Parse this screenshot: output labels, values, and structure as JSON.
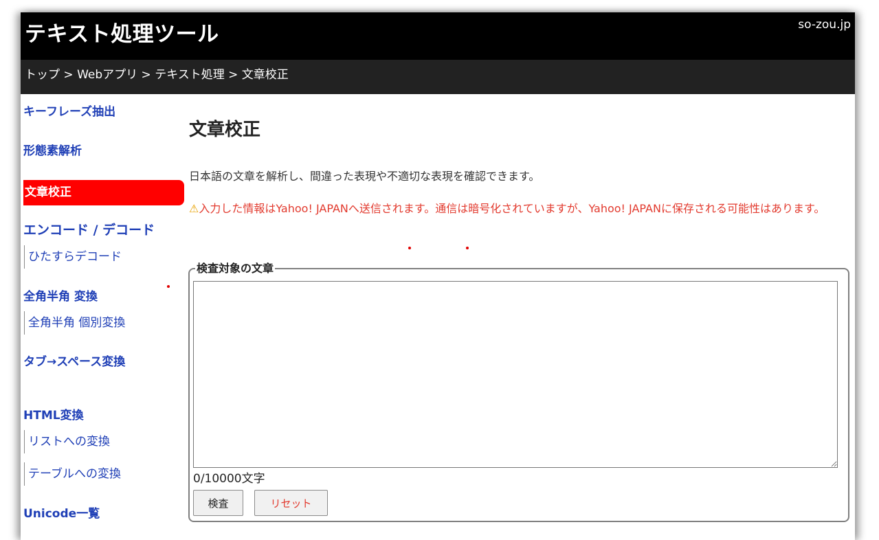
{
  "header": {
    "site_title": "テキスト処理ツール",
    "domain": "so-zou.jp"
  },
  "breadcrumb": [
    "トップ",
    ">",
    "Webアプリ",
    ">",
    "テキスト処理",
    ">",
    "文章校正"
  ],
  "sidebar": {
    "keyphrase": "キーフレーズ抽出",
    "morph": "形態素解析",
    "proofread": "文章校正",
    "encode_decode": "エンコード / デコード",
    "decode_sub": "ひたすらデコード",
    "zenkaku": "全角半角 変換",
    "zenkaku_sub": "全角半角 個別変換",
    "tab_space": "タブ→スペース変換",
    "html": "HTML変換",
    "html_list": "リストへの変換",
    "html_table": "テーブルへの変換",
    "unicode": "Unicode一覧"
  },
  "main": {
    "title": "文章校正",
    "description": "日本語の文章を解析し、間違った表現や不適切な表現を確認できます。",
    "warning_icon": "⚠",
    "warning": "入力した情報はYahoo! JAPANへ送信されます。通信は暗号化されていますが、Yahoo! JAPANに保存される可能性はあります。",
    "fieldset_legend": "検査対象の文章",
    "textarea_value": "",
    "counter": "0/10000文字",
    "check_button": "検査",
    "reset_button": "リセット"
  },
  "colors": {
    "header_bg": "#000000",
    "breadcrumb_bg": "#222222",
    "link": "#1f3fb6",
    "active_bg": "#ff0000",
    "warning": "#e23a2e"
  }
}
